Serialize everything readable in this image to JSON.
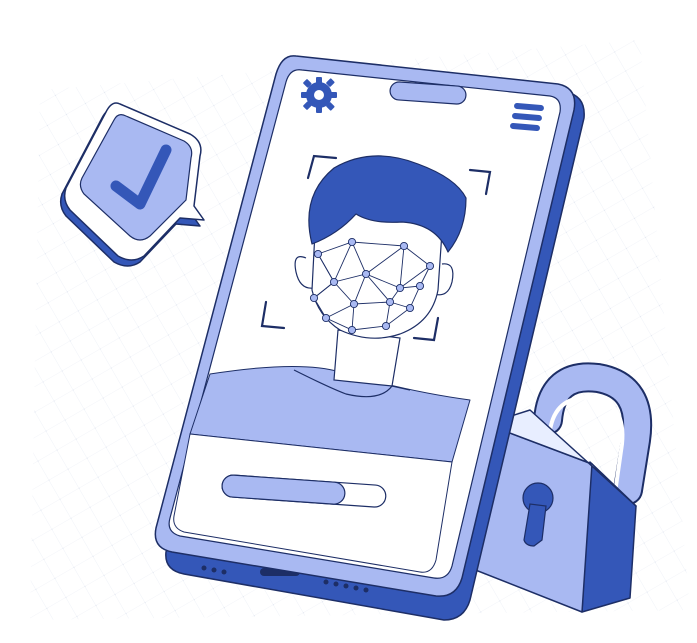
{
  "illustration": {
    "subject": "face-id-phone-unlock",
    "icons": {
      "check_bubble": "check-icon",
      "settings": "gear-icon",
      "menu": "menu-icon",
      "lock": "padlock-icon",
      "face_scan": "face-scan-icon"
    },
    "progress": {
      "fraction": 0.75
    },
    "colors": {
      "primary": "#3457b8",
      "light": "#a9b9f2",
      "pale": "#e8eeff",
      "outline": "#1d2e66",
      "white": "#ffffff",
      "background_grid": "#dfe5ef"
    }
  }
}
